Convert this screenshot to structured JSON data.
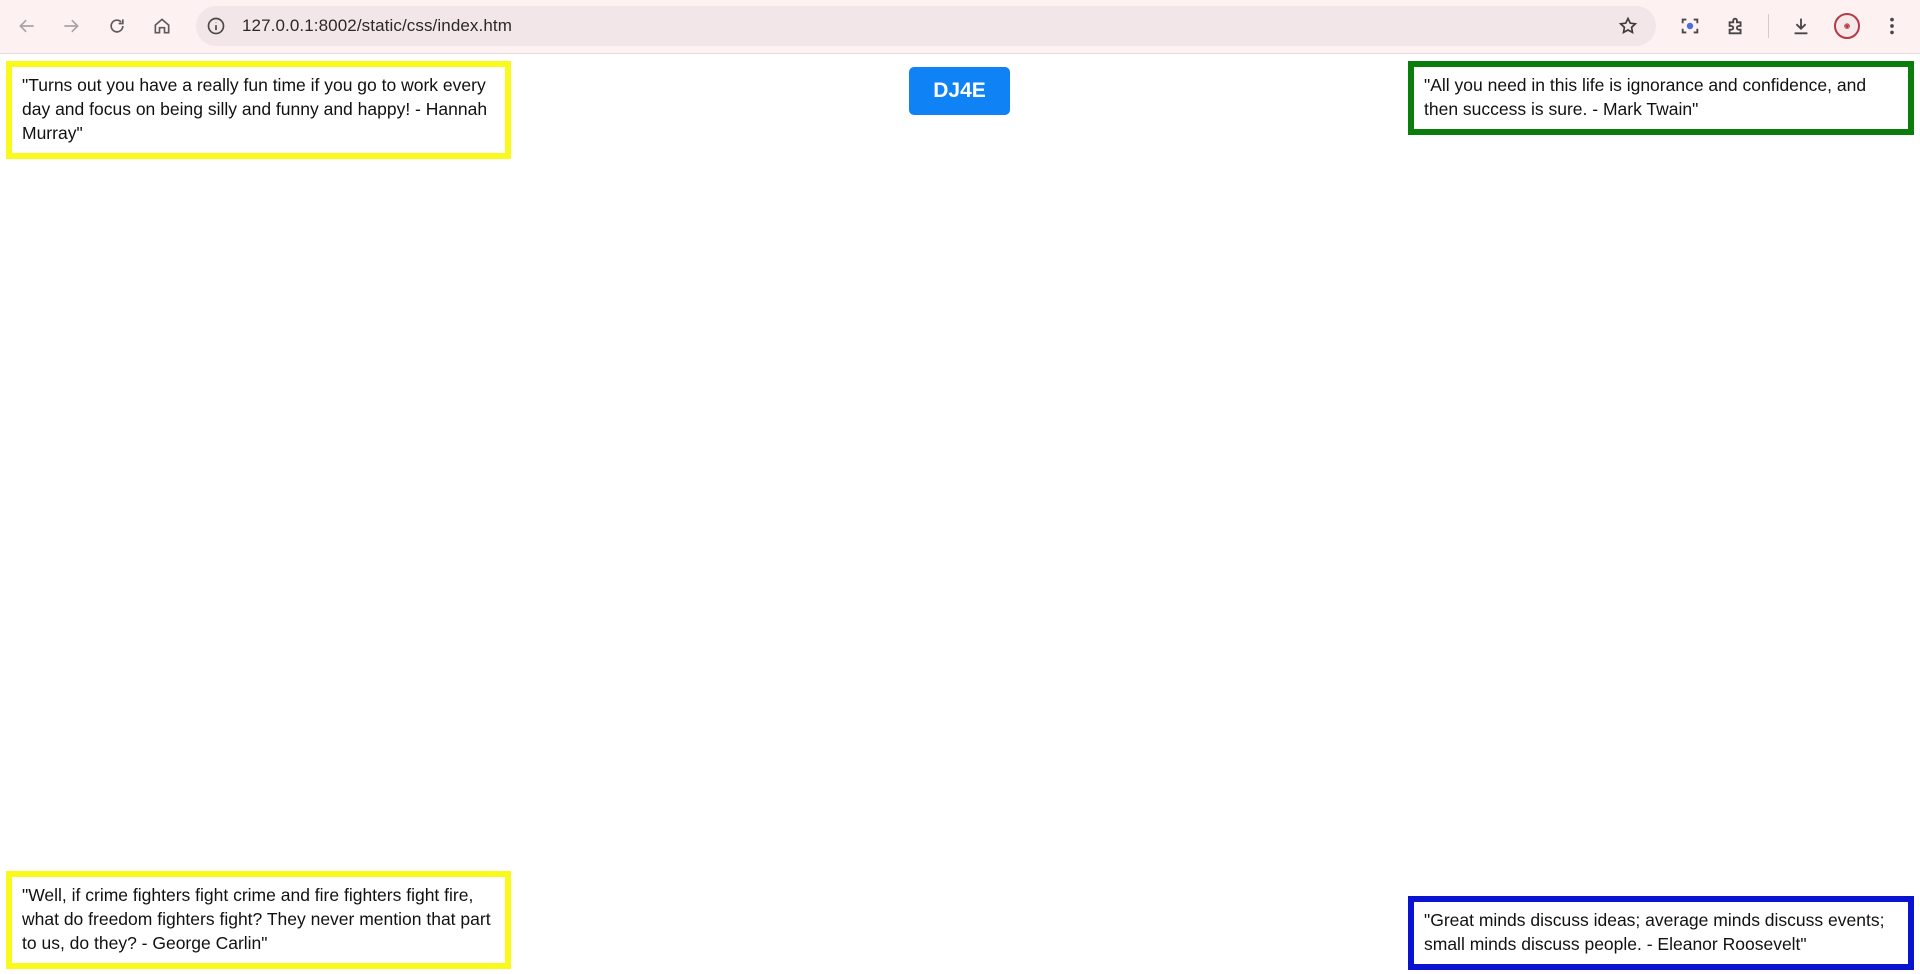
{
  "browser": {
    "url": "127.0.0.1:8002/static/css/index.htm",
    "icons": [
      "back-icon",
      "forward-icon",
      "reload-icon",
      "home-icon",
      "site-info-icon",
      "bookmark-star-icon",
      "lens-icon",
      "extensions-icon",
      "download-icon",
      "profile-avatar",
      "menu-icon"
    ]
  },
  "page": {
    "button_label": "DJ4E",
    "button_color": "#0f82f6",
    "quotes": {
      "top_left": {
        "text": "\"Turns out you have a really fun time if you go to work every day and focus on being silly and funny and happy! - Hannah Murray\"",
        "border_color": "#f9f91c"
      },
      "top_right": {
        "text": "\"All you need in this life is ignorance and confidence, and then success is sure. - Mark Twain\"",
        "border_color": "#0b7d0b"
      },
      "bottom_left": {
        "text": "\"Well, if crime fighters fight crime and fire fighters fight fire, what do freedom fighters fight? They never mention that part to us, do they? - George Carlin\"",
        "border_color": "#f9f91c"
      },
      "bottom_right": {
        "text": "\"Great minds discuss ideas; average minds discuss events; small minds discuss people. - Eleanor Roosevelt\"",
        "border_color": "#0a14d0"
      }
    }
  }
}
